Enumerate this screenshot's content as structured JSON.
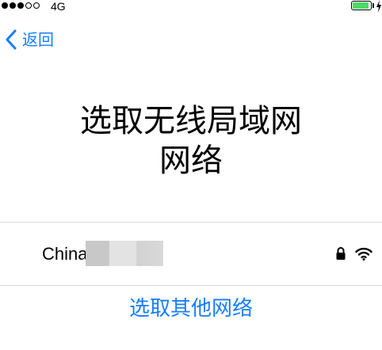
{
  "status_bar": {
    "signal_strength": {
      "filled": 3,
      "total": 5
    },
    "network_type": "4G",
    "battery_level": 0.9,
    "battery_color": "#4cd964"
  },
  "nav": {
    "back_label": "返回",
    "accent_color": "#157efb"
  },
  "title": {
    "line1": "选取无线局域网",
    "line2": "网络"
  },
  "networks": [
    {
      "name": "China",
      "secured": true,
      "signal_bars": 3
    }
  ],
  "other_networks_label": "选取其他网络"
}
